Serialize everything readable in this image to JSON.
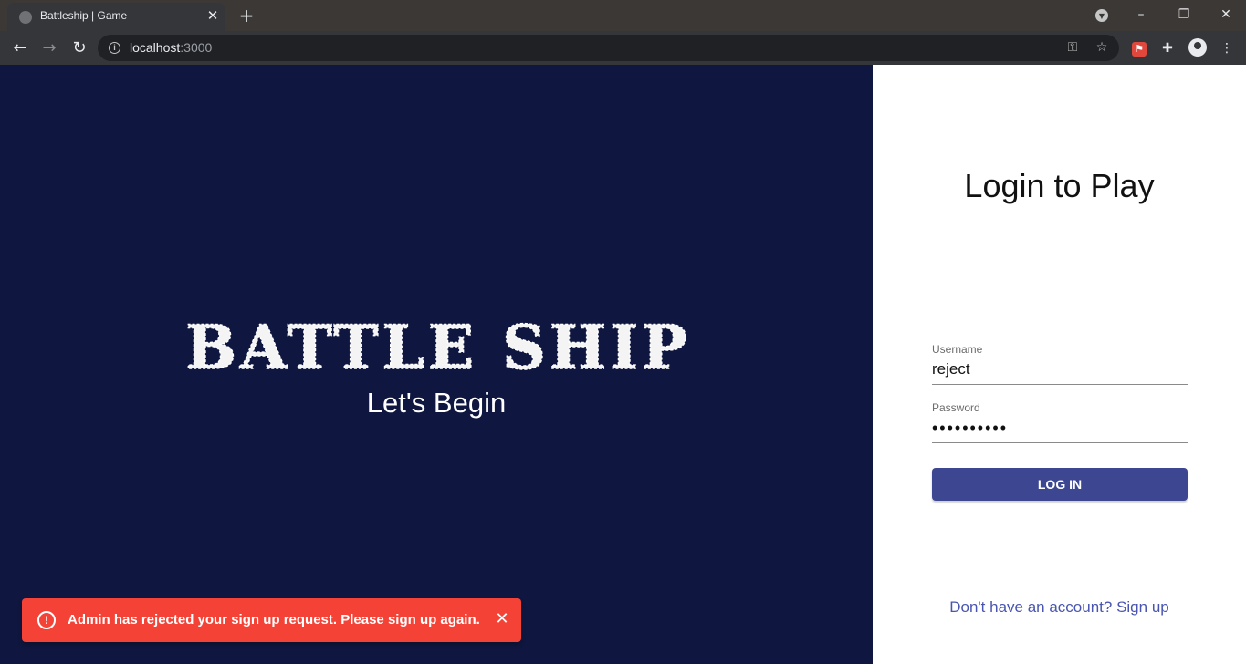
{
  "browser": {
    "tab_title": "Battleship | Game",
    "tab_close": "✕",
    "new_tab": "+",
    "url_host": "localhost",
    "url_port": ":3000",
    "min": "–",
    "restore": "❐",
    "close": "✕"
  },
  "hero": {
    "logo_text": "BATTLE SHIP",
    "subtitle": "Let's Begin"
  },
  "login": {
    "title": "Login to Play",
    "username_label": "Username",
    "username_value": "reject",
    "password_label": "Password",
    "password_value": "••••••••••",
    "login_button": "LOG IN",
    "signup_link": "Don't have an account? Sign up"
  },
  "snackbar": {
    "icon": "!",
    "message": "Admin has rejected your sign up request. Please sign up again.",
    "close": "✕"
  },
  "colors": {
    "left_bg": "#0f1740",
    "button": "#3c4691",
    "link": "#4955b0",
    "snackbar": "#f44336"
  },
  "icons": [
    "globe-icon",
    "back-arrow-icon",
    "forward-arrow-icon",
    "reload-icon",
    "info-icon",
    "key-icon",
    "star-icon",
    "extension-icon",
    "puzzle-icon",
    "profile-icon",
    "kebab-menu-icon",
    "error-icon",
    "close-icon"
  ]
}
